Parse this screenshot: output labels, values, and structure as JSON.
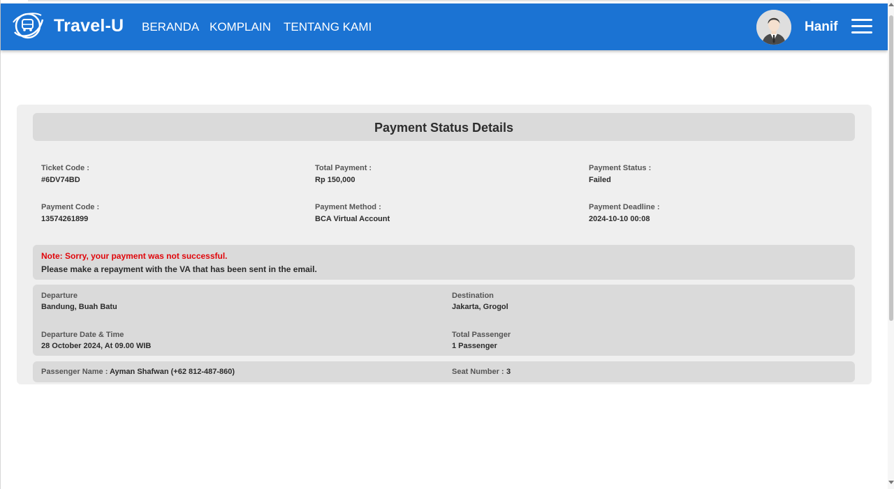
{
  "navbar": {
    "brand": "Travel-U",
    "links": [
      "BERANDA",
      "KOMPLAIN",
      "TENTANG KAMI"
    ],
    "username": "Hanif",
    "accent": "#1b73d3"
  },
  "page": {
    "title": "Payment Status Details",
    "fields": {
      "ticket_code": {
        "label": "Ticket Code :",
        "value": "#6DV74BD"
      },
      "total_payment": {
        "label": "Total Payment :",
        "value": "Rp 150,000"
      },
      "payment_status": {
        "label": "Payment Status :",
        "value": "Failed"
      },
      "payment_code": {
        "label": "Payment Code :",
        "value": "13574261899"
      },
      "payment_method": {
        "label": "Payment Method :",
        "value": "BCA Virtual Account"
      },
      "payment_deadline": {
        "label": "Payment Deadline :",
        "value": "2024-10-10 00:08"
      }
    },
    "note": {
      "headline": "Note: Sorry, your payment was not successful.",
      "text": "Please make a repayment with the VA that has been sent in the email.",
      "color": "#e0060b"
    },
    "trip": {
      "departure": {
        "label": "Departure",
        "value": "Bandung, Buah Batu"
      },
      "destination": {
        "label": "Destination",
        "value": "Jakarta, Grogol"
      },
      "datetime": {
        "label": "Departure Date & Time",
        "value": "28 October 2024, At 09.00 WIB"
      },
      "total_passenger": {
        "label": "Total Passenger",
        "value": "1 Passenger"
      }
    },
    "passenger": {
      "name_label": "Passenger Name :",
      "name_value": "Ayman Shafwan (+62 812-487-860)",
      "seat_label": "Seat Number :",
      "seat_value": "3"
    }
  }
}
